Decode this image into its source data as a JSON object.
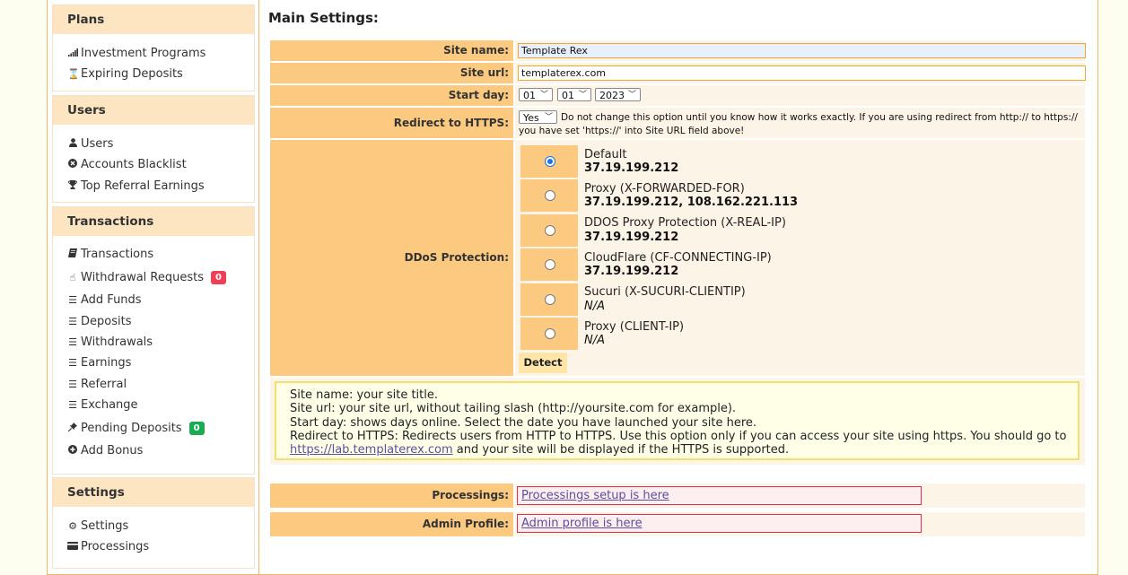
{
  "sidebar": {
    "plans": {
      "title": "Plans",
      "items": [
        {
          "label": "Investment Programs",
          "icon": "signal-bars-icon"
        },
        {
          "label": "Expiring Deposits",
          "icon": "hourglass-icon"
        }
      ]
    },
    "users": {
      "title": "Users",
      "items": [
        {
          "label": "Users",
          "icon": "user-icon"
        },
        {
          "label": "Accounts Blacklist",
          "icon": "ban-icon"
        },
        {
          "label": "Top Referral Earnings",
          "icon": "trophy-icon"
        }
      ]
    },
    "transactions": {
      "title": "Transactions",
      "items": [
        {
          "label": "Transactions",
          "icon": "book-icon"
        },
        {
          "label": "Withdrawal Requests",
          "icon": "hand-pointer-icon",
          "badge": "0"
        },
        {
          "label": "Add Funds",
          "icon": "list-icon"
        },
        {
          "label": "Deposits",
          "icon": "list-icon"
        },
        {
          "label": "Withdrawals",
          "icon": "list-icon"
        },
        {
          "label": "Earnings",
          "icon": "list-icon"
        },
        {
          "label": "Referral",
          "icon": "list-icon"
        },
        {
          "label": "Exchange",
          "icon": "list-icon"
        },
        {
          "label": "Pending Deposits",
          "icon": "thumbtack-icon",
          "badge": "0"
        },
        {
          "label": "Add Bonus",
          "icon": "plus-circle-icon"
        }
      ]
    },
    "settings": {
      "title": "Settings",
      "items": [
        {
          "label": "Settings",
          "icon": "gear-icon"
        },
        {
          "label": "Processings",
          "icon": "credit-card-icon"
        }
      ]
    }
  },
  "main": {
    "title": "Main Settings:",
    "site_name": {
      "label": "Site name:",
      "value": "Template Rex"
    },
    "site_url": {
      "label": "Site url:",
      "value": "templaterex.com"
    },
    "start_day": {
      "label": "Start day:",
      "day": "01",
      "month": "01",
      "year": "2023"
    },
    "redirect": {
      "label": "Redirect to HTTPS:",
      "value": "Yes",
      "note_line1": "Do not change this option until you know how it works exactly. If you are using redirect from http:// to https://",
      "note_line2": "you have set 'https://' into Site URL field above!"
    },
    "ddos": {
      "label": "DDoS Protection:",
      "options": [
        {
          "name": "Default",
          "ip": "37.19.199.212",
          "selected": true
        },
        {
          "name": "Proxy (X-FORWARDED-FOR)",
          "ip": "37.19.199.212, 108.162.221.113",
          "selected": false
        },
        {
          "name": "DDOS Proxy Protection (X-REAL-IP)",
          "ip": "37.19.199.212",
          "selected": false
        },
        {
          "name": "CloudFlare (CF-CONNECTING-IP)",
          "ip": "37.19.199.212",
          "selected": false
        },
        {
          "name": "Sucuri (X-SUCURI-CLIENTIP)",
          "ip": "N/A",
          "selected": false
        },
        {
          "name": "Proxy (CLIENT-IP)",
          "ip": "N/A",
          "selected": false
        }
      ],
      "detect_label": "Detect"
    },
    "help": {
      "line1": "Site name: your site title.",
      "line2": "Site url: your site url, without tailing slash (http://yoursite.com for example).",
      "line3": "Start day: shows days online. Select the date you have launched your site here.",
      "line4": "Redirect to HTTPS: Redirects users from HTTP to HTTPS. Use this option only if you can access your site using https. You should go to",
      "line5_link": "https://lab.templaterex.com",
      "line5_rest": " and your site will be displayed if the HTTPS is supported."
    },
    "processings": {
      "label": "Processings:",
      "link": "Processings setup is here"
    },
    "admin_profile": {
      "label": "Admin Profile:",
      "link": "Admin profile is here"
    }
  },
  "colors": {
    "label_bg": "#fbc97f",
    "header_bg": "#fde5c2",
    "badge_red": "#f03e57",
    "badge_green": "#1cab52",
    "link": "#5a4fa0"
  }
}
